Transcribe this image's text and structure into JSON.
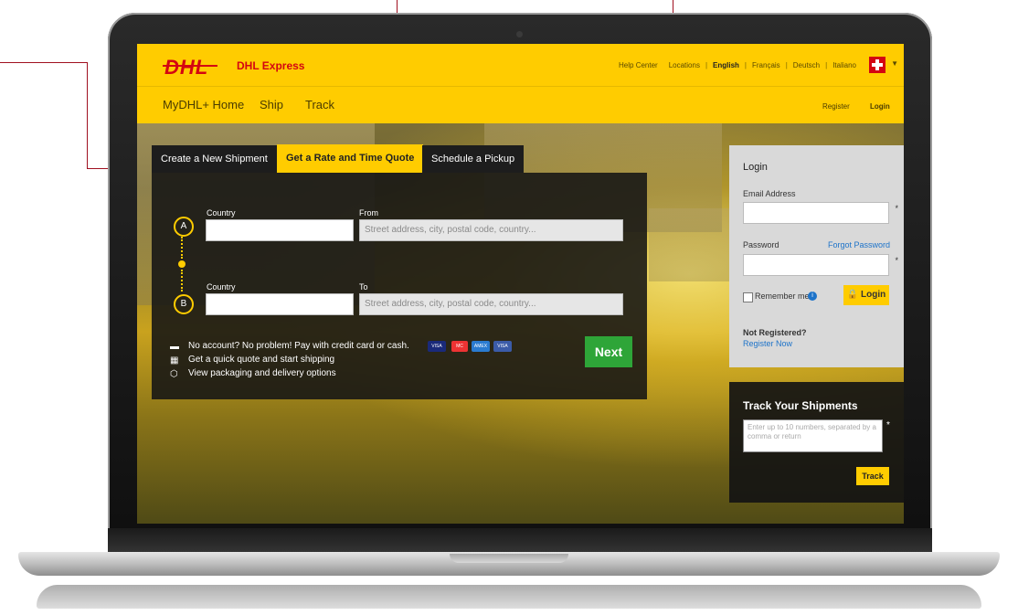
{
  "header": {
    "logo_text": "DHL",
    "brand": "DHL Express",
    "links": [
      "Help Center",
      "Locations",
      "English",
      "Français",
      "Deutsch",
      "Italiano"
    ],
    "active_language": "English",
    "flag": "swiss-flag-icon"
  },
  "nav": {
    "items": [
      "MyDHL+ Home",
      "Ship",
      "Track"
    ],
    "register": "Register",
    "login": "Login"
  },
  "tabs": [
    "Create a New Shipment",
    "Get a Rate and Time Quote",
    "Schedule a Pickup"
  ],
  "active_tab": "Get a Rate and Time Quote",
  "quote": {
    "a_label": "A",
    "b_label": "B",
    "country_label": "Country",
    "from_label": "From",
    "to_label": "To",
    "address_placeholder": "Street address, city, postal code, country...",
    "info": [
      "No account? No problem! Pay with credit card or cash.",
      "Get a quick quote and start shipping",
      "View packaging and delivery options"
    ],
    "cards": [
      "VISA",
      "MC",
      "AMEX",
      "VISA"
    ],
    "next": "Next"
  },
  "login": {
    "title": "Login",
    "email_label": "Email Address",
    "password_label": "Password",
    "forgot": "Forgot Password",
    "remember": "Remember me",
    "button": "Login",
    "not_registered": "Not Registered?",
    "register_now": "Register Now",
    "required": "*"
  },
  "track": {
    "title": "Track Your Shipments",
    "placeholder": "Enter up to 10 numbers, separated by a comma or return",
    "button": "Track",
    "required": "*"
  },
  "colors": {
    "brand_yellow": "#ffcc00",
    "brand_red": "#d40511",
    "next_green": "#2ea538",
    "link_blue": "#1d73c9"
  }
}
